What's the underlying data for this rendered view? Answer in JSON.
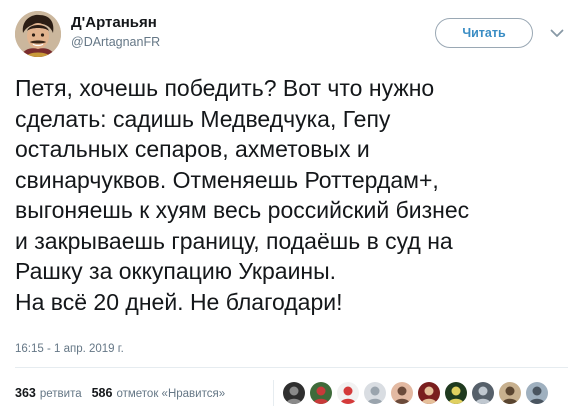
{
  "author": {
    "display_name": "Д'Артаньян",
    "handle": "@DArtagnanFR"
  },
  "follow_button_label": "Читать",
  "tweet_lines": [
    "Петя, хочешь победить? Вот что нужно",
    "сделать: садишь Медведчука, Гепу",
    "остальных сепаров, ахметовых и",
    "свинарчуквов. Отменяешь Роттердам+,",
    "выгоняешь к хуям весь российский бизнес",
    "и закрываешь границу, подаёшь в суд на",
    "Рашку за оккупацию Украины.",
    "На всё 20 дней. Не благодари!"
  ],
  "timestamp": "16:15 - 1 апр. 2019 г.",
  "stats": {
    "retweets_count": "363",
    "retweets_label": "ретвита",
    "likes_count": "586",
    "likes_label": "отметок «Нравится»"
  },
  "icons": {
    "caret": "chevron-down-icon",
    "avatar": "avatar"
  },
  "colors": {
    "link_blue": "#3a8dc4",
    "muted_gray": "#657786",
    "text_dark": "#14171a",
    "divider": "#e6ecf0"
  },
  "liker_avatars": [
    {
      "bg": "#2f2f2f",
      "fg": "#8a8a8a"
    },
    {
      "bg": "#3f6b3a",
      "fg": "#c83a3a"
    },
    {
      "bg": "#f2f2f2",
      "fg": "#d43a3a"
    },
    {
      "bg": "#d9dde2",
      "fg": "#9aa4ad"
    },
    {
      "bg": "#e3b9a2",
      "fg": "#6b4a3a"
    },
    {
      "bg": "#7a1e1e",
      "fg": "#e6c09a"
    },
    {
      "bg": "#1f3a1f",
      "fg": "#e0d060"
    },
    {
      "bg": "#56606a",
      "fg": "#c0c8d0"
    },
    {
      "bg": "#c7b08e",
      "fg": "#5a4530"
    },
    {
      "bg": "#9fb0bf",
      "fg": "#4a5560"
    }
  ]
}
